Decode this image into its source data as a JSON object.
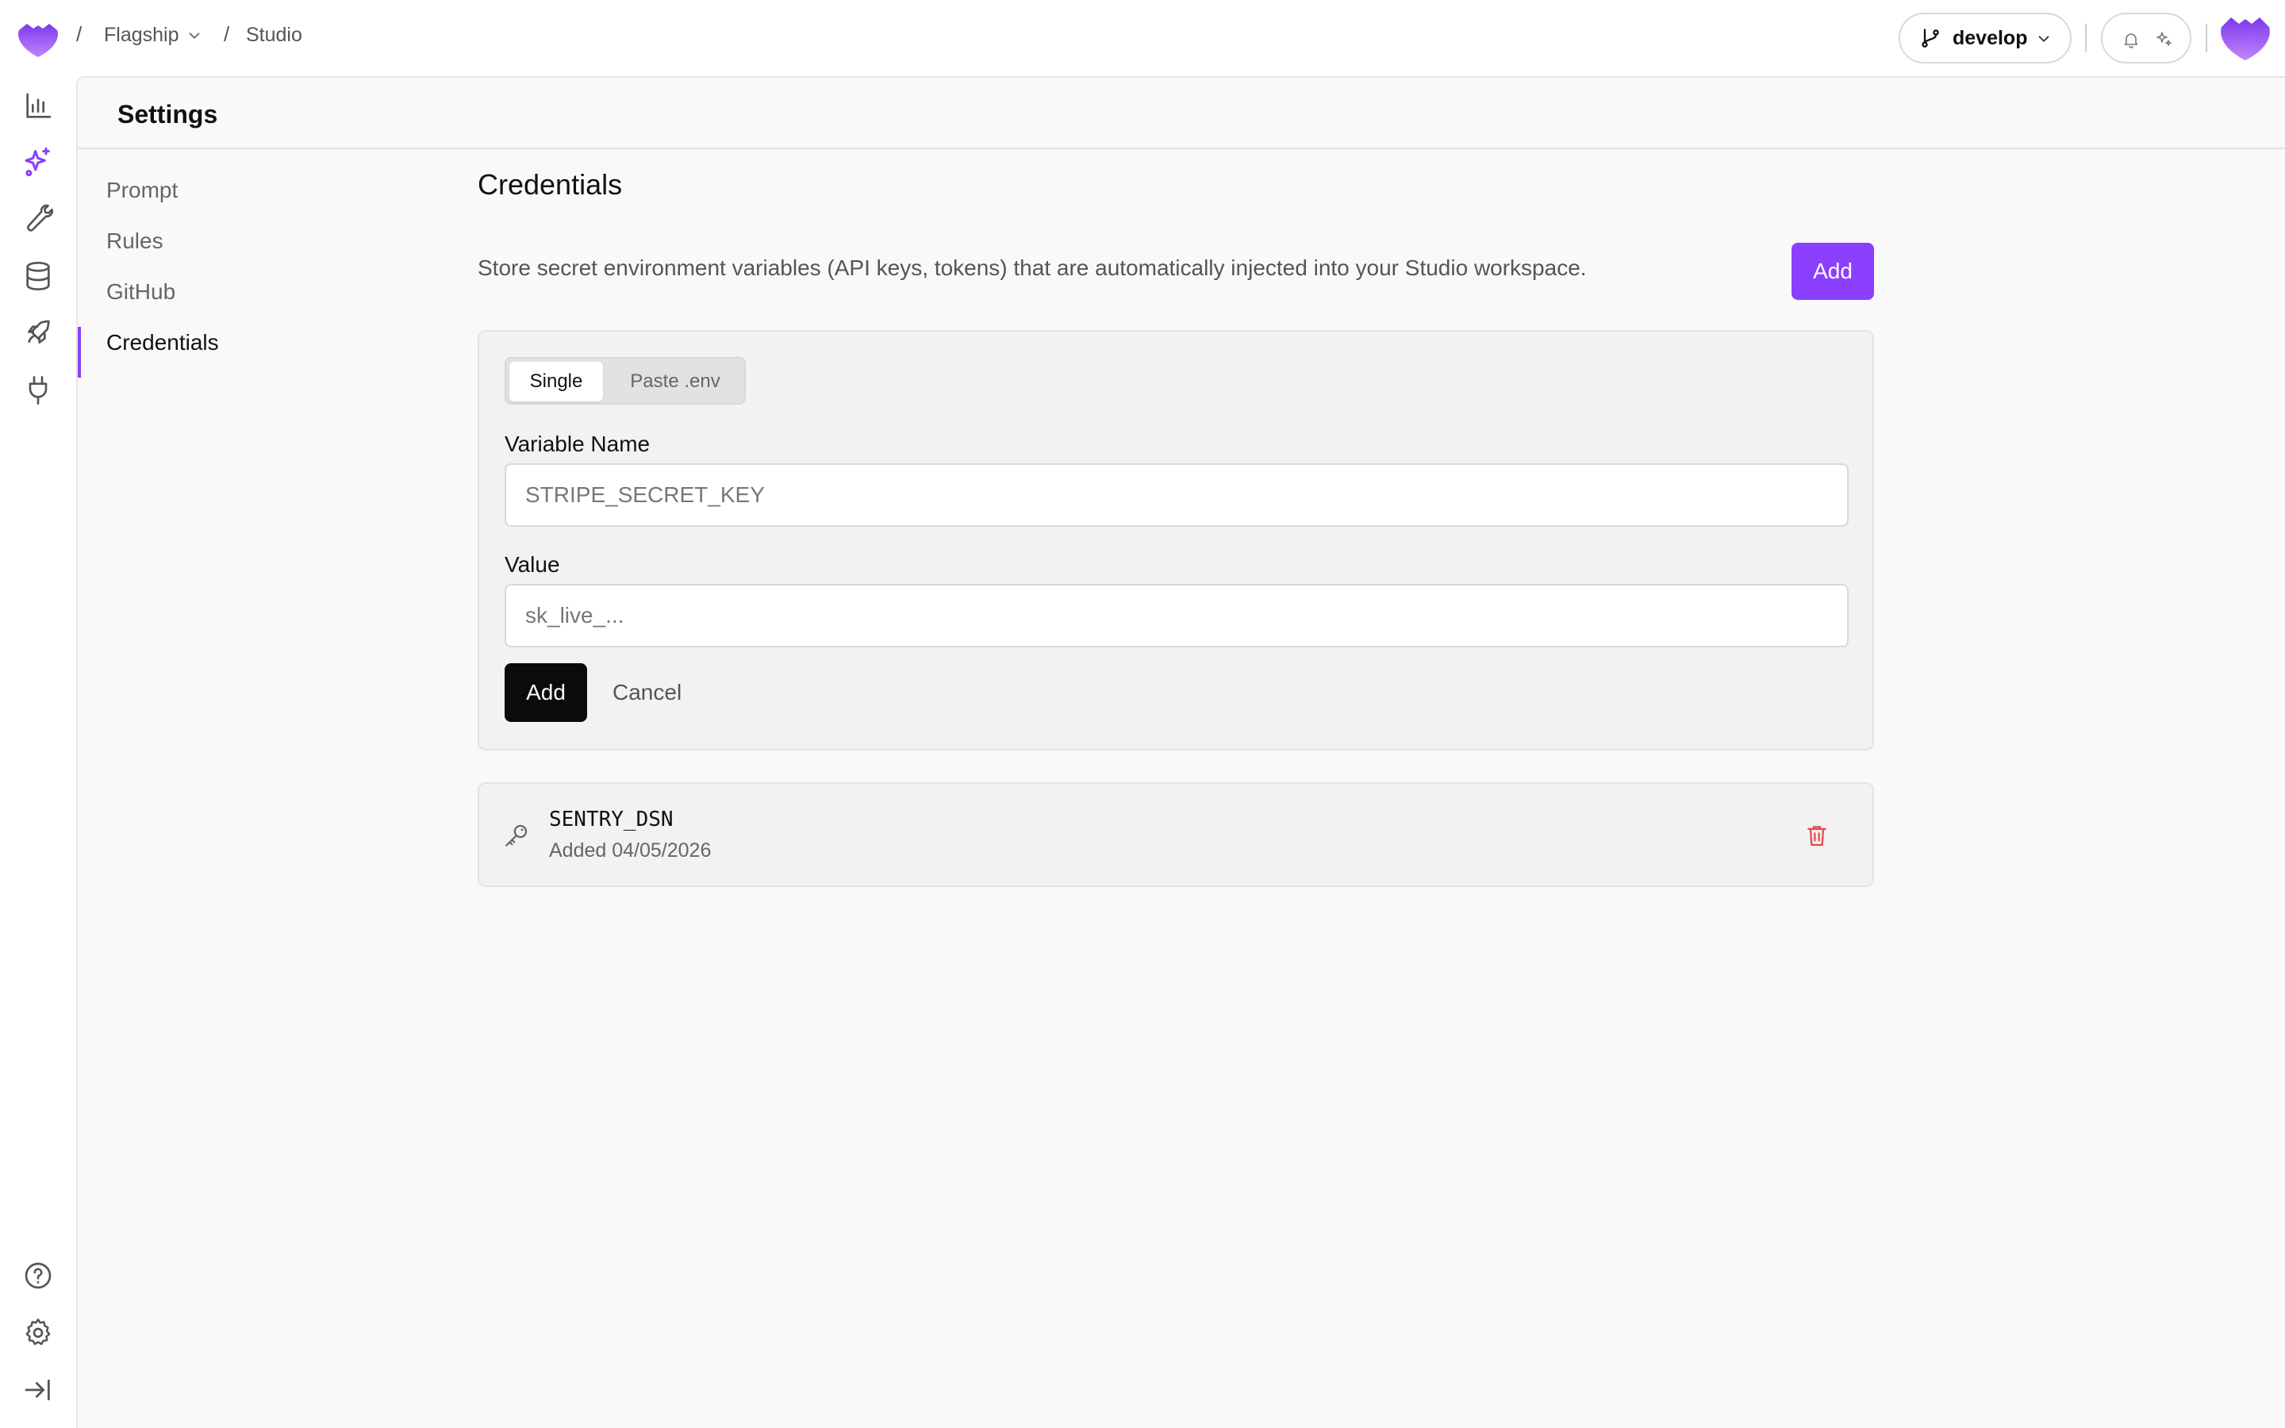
{
  "breadcrumb": {
    "separator": "/",
    "project": "Flagship",
    "page": "Studio"
  },
  "header": {
    "branch": "develop",
    "icons": [
      "bell-icon",
      "sparkle-settings-icon"
    ]
  },
  "rail": {
    "items": [
      "chart-icon",
      "sparkles-icon",
      "wrench-icon",
      "database-icon",
      "rocket-icon",
      "plug-icon"
    ],
    "bottom": [
      "help-icon",
      "gear-icon",
      "collapse-icon"
    ]
  },
  "panel": {
    "title": "Settings"
  },
  "subnav": {
    "items": [
      {
        "label": "Prompt"
      },
      {
        "label": "Rules"
      },
      {
        "label": "GitHub"
      },
      {
        "label": "Credentials"
      }
    ],
    "active": "Credentials"
  },
  "credentials": {
    "title": "Credentials",
    "description": "Store secret environment variables (API keys, tokens) that are automatically injected into your Studio workspace.",
    "add_label": "Add",
    "form": {
      "mode_single": "Single",
      "mode_paste": "Paste .env",
      "name_label": "Variable Name",
      "name_placeholder": "STRIPE_SECRET_KEY",
      "value_label": "Value",
      "value_placeholder": "sk_live_...",
      "submit_label": "Add",
      "cancel_label": "Cancel"
    },
    "list": [
      {
        "name": "SENTRY_DSN",
        "added": "Added 04/05/2026"
      }
    ]
  },
  "colors": {
    "accent": "#8a3ffc",
    "danger": "#e5484d",
    "logo_top": "#7c3aed",
    "logo_bottom": "#c084fc"
  }
}
